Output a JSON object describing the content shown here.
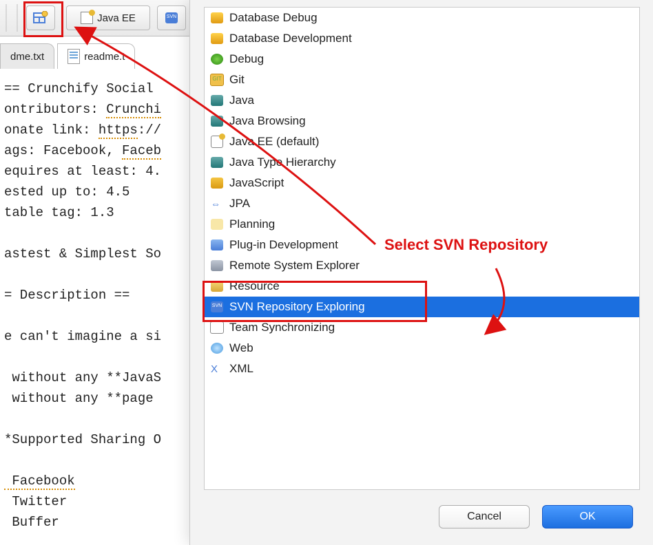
{
  "toolbar": {
    "javaee_label": "Java EE"
  },
  "tabs": {
    "left": "dme.txt",
    "active": "readme.t"
  },
  "editor": {
    "l1": "== Crunchify Social ",
    "l2a": "ontributors: ",
    "l2b": "Crunchi",
    "l3a": "onate link: ",
    "l3b": "https",
    "l3c": ":/",
    "l4a": "ags: Facebook, ",
    "l4b": "Faceb",
    "l5": "equires at least: 4.",
    "l6": "ested up to: 4.5",
    "l7": "table tag: 1.3",
    "l8": "astest & Simplest So",
    "l9": "= Description ==",
    "l10": "e can't imagine a si",
    "l11": " without any **JavaS",
    "l12": " without any **page ",
    "l13": "*Supported Sharing O",
    "l14": " Facebook",
    "l15": " Twitter",
    "l16": " Buffer"
  },
  "perspectives": [
    {
      "id": "database-debug",
      "label": "Database Debug",
      "ico": "b-db"
    },
    {
      "id": "database-dev",
      "label": "Database Development",
      "ico": "b-db"
    },
    {
      "id": "debug",
      "label": "Debug",
      "ico": "b-bug"
    },
    {
      "id": "git",
      "label": "Git",
      "ico": "b-git"
    },
    {
      "id": "java",
      "label": "Java",
      "ico": "b-java"
    },
    {
      "id": "java-browsing",
      "label": "Java Browsing",
      "ico": "b-java"
    },
    {
      "id": "java-ee",
      "label": "Java EE (default)",
      "ico": "b-jee"
    },
    {
      "id": "java-type-hier",
      "label": "Java Type Hierarchy",
      "ico": "b-java"
    },
    {
      "id": "javascript",
      "label": "JavaScript",
      "ico": "b-js"
    },
    {
      "id": "jpa",
      "label": "JPA",
      "ico": "b-jpa",
      "glyph": "⇔"
    },
    {
      "id": "planning",
      "label": "Planning",
      "ico": "b-plan"
    },
    {
      "id": "plugin-dev",
      "label": "Plug-in Development",
      "ico": "b-plug"
    },
    {
      "id": "remote-sys",
      "label": "Remote System Explorer",
      "ico": "b-remote"
    },
    {
      "id": "resource",
      "label": "Resource",
      "ico": "b-res"
    },
    {
      "id": "svn-repo",
      "label": "SVN Repository Exploring",
      "ico": "b-svn",
      "selected": true
    },
    {
      "id": "team-sync",
      "label": "Team Synchronizing",
      "ico": "b-team"
    },
    {
      "id": "web",
      "label": "Web",
      "ico": "b-web"
    },
    {
      "id": "xml",
      "label": "XML",
      "ico": "b-xml",
      "glyph": "X"
    }
  ],
  "buttons": {
    "cancel": "Cancel",
    "ok": "OK"
  },
  "annotation": {
    "text": "Select SVN Repository"
  }
}
